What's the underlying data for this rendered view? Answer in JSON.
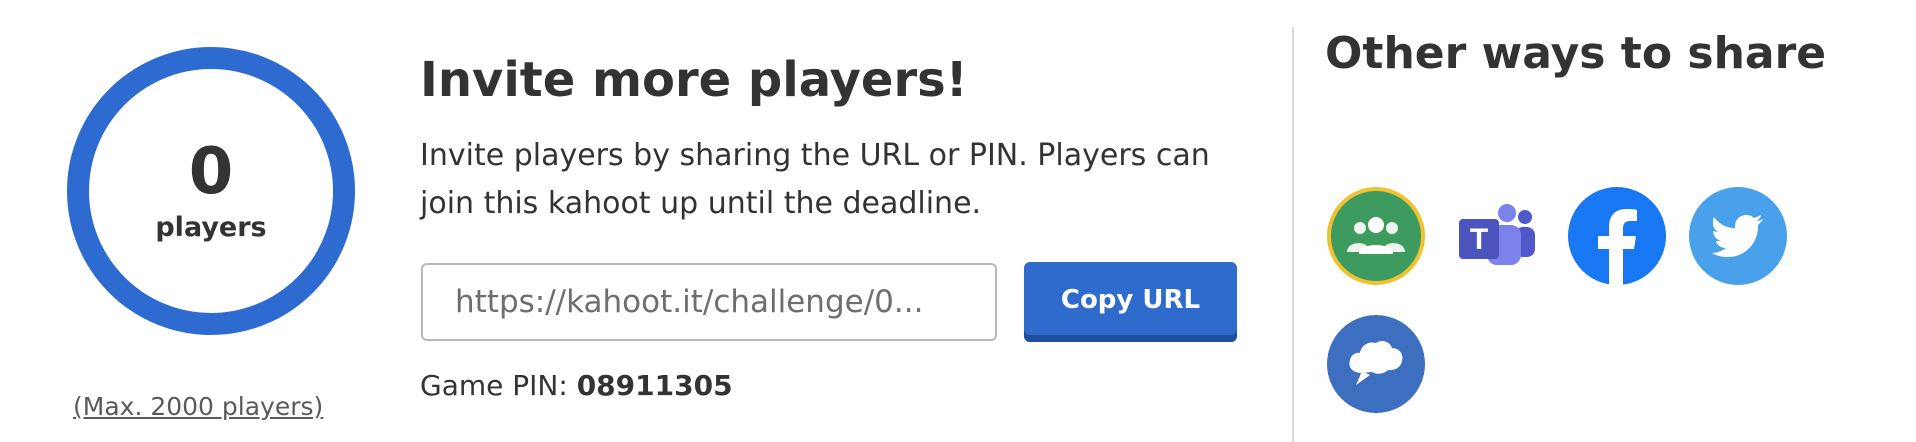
{
  "players": {
    "count": "0",
    "label": "players",
    "max_label": "(Max. 2000 players)"
  },
  "invite": {
    "title": "Invite more players!",
    "description": "Invite players by sharing the URL or PIN. Players can join this kahoot up until the deadline.",
    "url_value": "https://kahoot.it/challenge/0...",
    "copy_label": "Copy URL",
    "pin_label": "Game PIN:",
    "pin_value": "08911305"
  },
  "share": {
    "title": "Other ways to share",
    "buttons": [
      {
        "name": "google-classroom",
        "icon": "google-classroom-icon"
      },
      {
        "name": "microsoft-teams",
        "icon": "microsoft-teams-icon"
      },
      {
        "name": "facebook",
        "icon": "facebook-icon"
      },
      {
        "name": "twitter",
        "icon": "twitter-icon"
      },
      {
        "name": "remind",
        "icon": "remind-icon"
      }
    ]
  },
  "colors": {
    "ring": "#2e6bd1",
    "copy_button": "#2f6bcc",
    "classroom_green": "#3e9b5f",
    "classroom_border": "#f0c230",
    "teams_purple": "#5b5fc7",
    "facebook_blue": "#1877f2",
    "twitter_blue": "#4aa1eb",
    "remind_blue": "#3d6fc1"
  }
}
